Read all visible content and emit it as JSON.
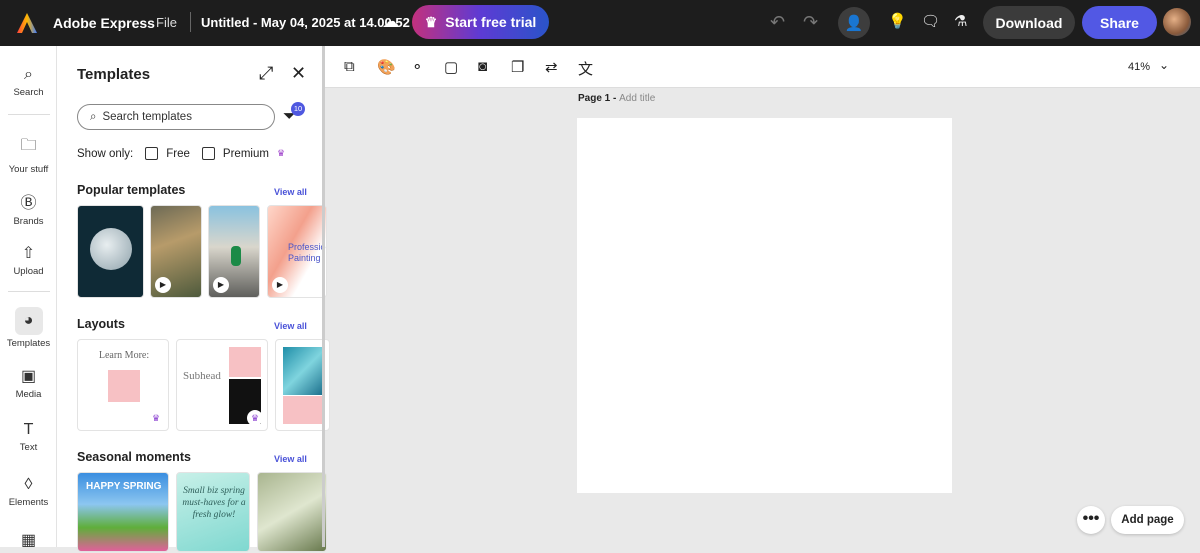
{
  "topbar": {
    "app_name": "Adobe Express",
    "file_menu": "File",
    "doc_title": "Untitled - May 04, 2025 at 14.00.52",
    "trial_label": "Start free trial",
    "download_label": "Download",
    "share_label": "Share"
  },
  "rail": [
    {
      "label": "Search",
      "icon": "⌕"
    },
    {
      "label": "Your stuff",
      "icon": "🗀"
    },
    {
      "label": "Brands",
      "icon": "Ⓑ"
    },
    {
      "label": "Upload",
      "icon": "⇧"
    },
    {
      "label": "Templates",
      "icon": "◕"
    },
    {
      "label": "Media",
      "icon": "▣"
    },
    {
      "label": "Text",
      "icon": "T"
    },
    {
      "label": "Elements",
      "icon": "◊"
    }
  ],
  "panel": {
    "title": "Templates",
    "search_placeholder": "Search templates",
    "filter_count": "10",
    "show_only": "Show only:",
    "free": "Free",
    "premium": "Premium",
    "sections": [
      {
        "title": "Popular templates",
        "view_all": "View all"
      },
      {
        "title": "Layouts",
        "view_all": "View all"
      },
      {
        "title": "Seasonal moments",
        "view_all": "View all"
      }
    ],
    "thumb_text": {
      "learn_more": "Learn More:",
      "subhead": "Subhead",
      "professional": "Professional Painting",
      "small_biz": "Small biz spring must-haves for a fresh glow!",
      "happy_spring": "HAPPY SPRING"
    }
  },
  "canvas": {
    "zoom": "41%",
    "page_label": "Page 1 -",
    "add_title": "Add title",
    "add_page": "Add page"
  }
}
